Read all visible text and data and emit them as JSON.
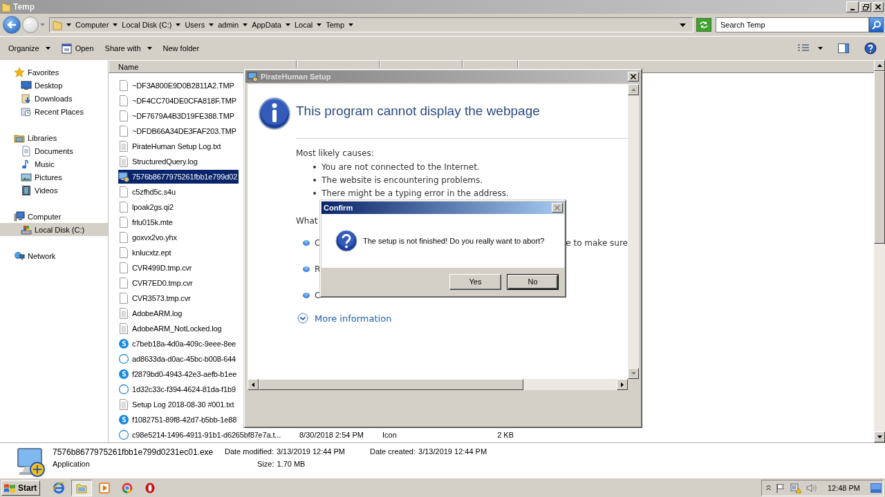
{
  "window": {
    "title": "Temp"
  },
  "address_bar": {
    "crumbs": [
      "Computer",
      "Local Disk (C:)",
      "Users",
      "admin",
      "AppData",
      "Local",
      "Temp"
    ]
  },
  "search": {
    "placeholder": "Search Temp"
  },
  "toolbar": [
    {
      "label": "Organize",
      "kind": "menu"
    },
    {
      "label": "Open",
      "kind": "icon"
    },
    {
      "label": "Share with",
      "kind": "menu"
    },
    {
      "label": "New folder",
      "kind": "plain"
    }
  ],
  "nav": [
    {
      "label": "Favorites",
      "kind": "star",
      "selected": false,
      "children": [
        {
          "label": "Desktop",
          "kind": "desktop",
          "selected": false
        },
        {
          "label": "Downloads",
          "kind": "downloads",
          "selected": false
        },
        {
          "label": "Recent Places",
          "kind": "recent",
          "selected": false
        }
      ]
    },
    {
      "label": "Libraries",
      "kind": "library",
      "selected": false,
      "children": [
        {
          "label": "Documents",
          "kind": "documents",
          "selected": false
        },
        {
          "label": "Music",
          "kind": "music",
          "selected": false
        },
        {
          "label": "Pictures",
          "kind": "pictures",
          "selected": false
        },
        {
          "label": "Videos",
          "kind": "videos",
          "selected": false
        }
      ]
    },
    {
      "label": "Computer",
      "kind": "computer",
      "selected": false,
      "children": [
        {
          "label": "Local Disk (C:)",
          "kind": "disk",
          "selected": true
        }
      ]
    },
    {
      "label": "Network",
      "kind": "network",
      "selected": false
    }
  ],
  "columns": [
    "Name"
  ],
  "files": [
    {
      "name": "~DF3A800E9D0B2811A2.TMP",
      "kind": "blank",
      "selected": false
    },
    {
      "name": "~DF4CC704DE0CFA818F.TMP",
      "kind": "blank",
      "selected": false
    },
    {
      "name": "~DF7679A4B3D19FE388.TMP",
      "kind": "blank",
      "selected": false
    },
    {
      "name": "~DFDB66A34DE3FAF203.TMP",
      "kind": "blank",
      "selected": false
    },
    {
      "name": "PirateHuman Setup Log.txt",
      "kind": "text",
      "selected": false
    },
    {
      "name": "StructuredQuery.log",
      "kind": "text",
      "selected": false
    },
    {
      "name": "7576b8677975261fbb1e799d02",
      "kind": "app",
      "selected": true
    },
    {
      "name": "c5zfhd5c.s4u",
      "kind": "blank",
      "selected": false
    },
    {
      "name": "lpoak2gs.qi2",
      "kind": "blank",
      "selected": false
    },
    {
      "name": "frlu015k.mte",
      "kind": "blank",
      "selected": false
    },
    {
      "name": "goxvx2vo.yhx",
      "kind": "blank",
      "selected": false
    },
    {
      "name": "knlucxtz.ept",
      "kind": "blank",
      "selected": false
    },
    {
      "name": "CVR499D.tmp.cvr",
      "kind": "blank",
      "selected": false
    },
    {
      "name": "CVR7ED0.tmp.cvr",
      "kind": "blank",
      "selected": false
    },
    {
      "name": "CVR3573.tmp.cvr",
      "kind": "blank",
      "selected": false
    },
    {
      "name": "AdobeARM.log",
      "kind": "text",
      "selected": false
    },
    {
      "name": "AdobeARM_NotLocked.log",
      "kind": "text",
      "selected": false
    },
    {
      "name": "c7beb18a-4d0a-409c-9eee-8ee",
      "kind": "bubble",
      "selected": false
    },
    {
      "name": "ad8633da-d0ac-45bc-b008-644",
      "kind": "ring",
      "selected": false
    },
    {
      "name": "f2879bd0-4943-42e3-aefb-b1ee",
      "kind": "bubble",
      "selected": false
    },
    {
      "name": "1d32c33c-f394-4624-81da-f1b9",
      "kind": "ring",
      "selected": false
    },
    {
      "name": "Setup Log 2018-08-30 #001.txt",
      "kind": "text",
      "selected": false
    },
    {
      "name": "f1082751-89f8-42d7-b5bb-1e88",
      "kind": "bubble",
      "selected": false
    },
    {
      "name": "c98e5214-1496-4911-91b1-d6265bf87e7a.t...",
      "kind": "ring",
      "selected": false,
      "date": "8/30/2018 2:54 PM",
      "type": "Icon",
      "size": "2 KB"
    }
  ],
  "details": {
    "name": "7576b8677975261fbb1e799d0231ec01.exe",
    "type": "Application",
    "fields": [
      {
        "label": "Date modified:",
        "value": "3/13/2019 12:44 PM"
      },
      {
        "label": "Date created:",
        "value": "3/13/2019 12:44 PM"
      },
      {
        "label": "Size:",
        "value": "1.70 MB"
      }
    ]
  },
  "setup_dialog": {
    "title": "PirateHuman Setup",
    "heading": "This program cannot display the webpage",
    "causes_label": "Most likely causes:",
    "causes": [
      "You are not connected to the Internet.",
      "The website is encountering problems.",
      "There might be a typing error in the address."
    ],
    "what_label": "What",
    "actions": [
      {
        "lead": "C",
        "tail": "e to make sure"
      },
      {
        "lead": "R"
      },
      {
        "lead": "C"
      }
    ],
    "more": "More information"
  },
  "confirm": {
    "title": "Confirm",
    "message": "The setup is not finished! Do you really want to abort?",
    "buttons": [
      {
        "label": "Yes",
        "focused": false
      },
      {
        "label": "No",
        "focused": true
      }
    ]
  },
  "taskbar": {
    "start": "Start",
    "apps": [
      {
        "kind": "ie",
        "active": false
      },
      {
        "kind": "explorer",
        "active": true
      },
      {
        "kind": "media",
        "active": false
      },
      {
        "kind": "chrome",
        "active": false
      },
      {
        "kind": "stop",
        "active": false
      }
    ],
    "clock": "12:48 PM"
  }
}
